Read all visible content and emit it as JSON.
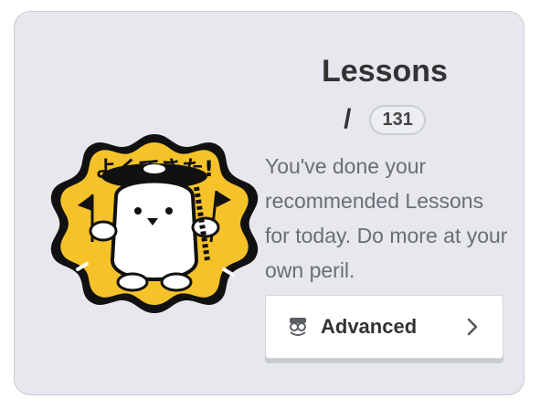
{
  "card": {
    "title": "Lessons",
    "separator": "/",
    "count": "131",
    "description": "You've done your recommended Lessons for today. Do more at your own peril.",
    "badge": {
      "icon": "well-done-stamp-icon",
      "stamp_text": "よくできた!",
      "color": "#f6c22a"
    },
    "button": {
      "label": "Advanced",
      "icon": "crabigator-icon",
      "trailing_icon": "chevron-right-icon"
    }
  }
}
